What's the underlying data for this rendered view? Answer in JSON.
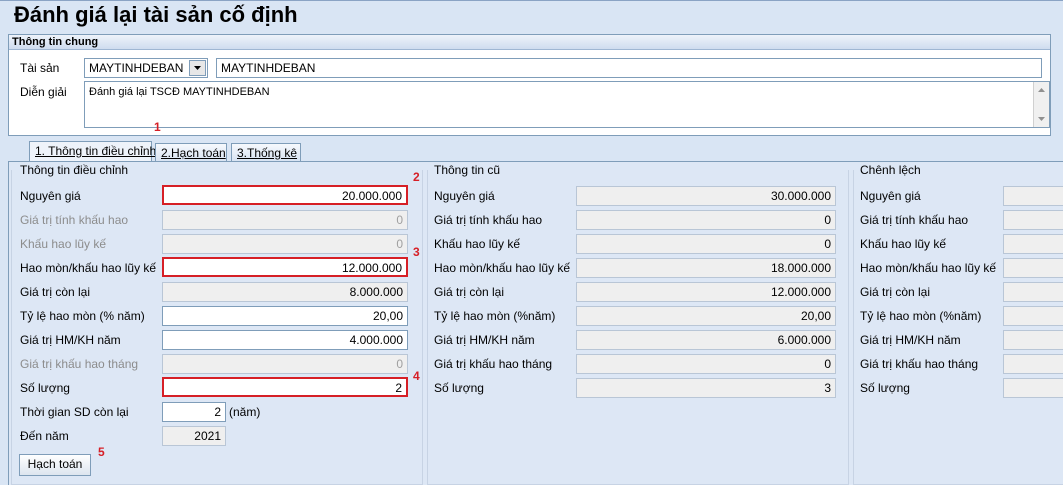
{
  "window_title": "Đánh giá lại tài sản cố định",
  "general": {
    "section_title": "Thông tin chung",
    "asset_label": "Tài sản",
    "asset_code": "MAYTINHDEBAN",
    "asset_name": "MAYTINHDEBAN",
    "desc_label": "Diễn giải",
    "desc_value": "Đánh giá lại TSCĐ MAYTINHDEBAN"
  },
  "tabs": [
    "1. Thông tin điều chỉnh",
    "2.Hạch toán",
    "3.Thống kê"
  ],
  "adjust": {
    "title": "Thông tin điều chỉnh",
    "rows": [
      {
        "label": "Nguyên giá",
        "value": "20.000.000"
      },
      {
        "label": "Giá trị tính khấu hao",
        "value": "0"
      },
      {
        "label": "Khấu hao lũy kế",
        "value": "0"
      },
      {
        "label": "Hao mòn/khấu hao lũy kế",
        "value": "12.000.000"
      },
      {
        "label": "Giá trị còn lại",
        "value": "8.000.000"
      },
      {
        "label": "Tỷ lệ hao mòn (% năm)",
        "value": "20,00"
      },
      {
        "label": "Giá trị HM/KH năm",
        "value": "4.000.000"
      },
      {
        "label": "Giá trị khấu hao tháng",
        "value": "0"
      },
      {
        "label": "Số lượng",
        "value": "2"
      }
    ],
    "remaining_label": "Thời gian SD còn lại",
    "remaining_value": "2",
    "remaining_unit": "(năm)",
    "end_year_label": "Đến năm",
    "end_year_value": "2021",
    "post_button": "Hạch toán"
  },
  "old": {
    "title": "Thông tin cũ",
    "rows": [
      {
        "label": "Nguyên giá",
        "value": "30.000.000"
      },
      {
        "label": "Giá trị tính khấu hao",
        "value": "0"
      },
      {
        "label": "Khấu hao lũy kế",
        "value": "0"
      },
      {
        "label": "Hao mòn/khấu hao lũy kế",
        "value": "18.000.000"
      },
      {
        "label": "Giá trị còn lại",
        "value": "12.000.000"
      },
      {
        "label": "Tỷ lệ hao mòn (%năm)",
        "value": "20,00"
      },
      {
        "label": "Giá trị HM/KH năm",
        "value": "6.000.000"
      },
      {
        "label": "Giá trị khấu hao tháng",
        "value": "0"
      },
      {
        "label": "Số lượng",
        "value": "3"
      }
    ]
  },
  "diff": {
    "title": "Chênh lệch",
    "rows": [
      {
        "label": "Nguyên giá"
      },
      {
        "label": "Giá trị tính khấu hao"
      },
      {
        "label": "Khấu hao lũy kế"
      },
      {
        "label": "Hao mòn/khấu hao lũy kế"
      },
      {
        "label": "Giá trị còn lại"
      },
      {
        "label": "Tỷ lệ hao mòn (%năm)"
      },
      {
        "label": "Giá trị HM/KH năm"
      },
      {
        "label": "Giá trị khấu hao tháng"
      },
      {
        "label": "Số lượng"
      }
    ]
  },
  "annotations": [
    "1",
    "2",
    "3",
    "4",
    "5"
  ],
  "colors": {
    "highlight": "#d61f26",
    "panel": "#d9e5f4",
    "border": "#7f9db9"
  }
}
